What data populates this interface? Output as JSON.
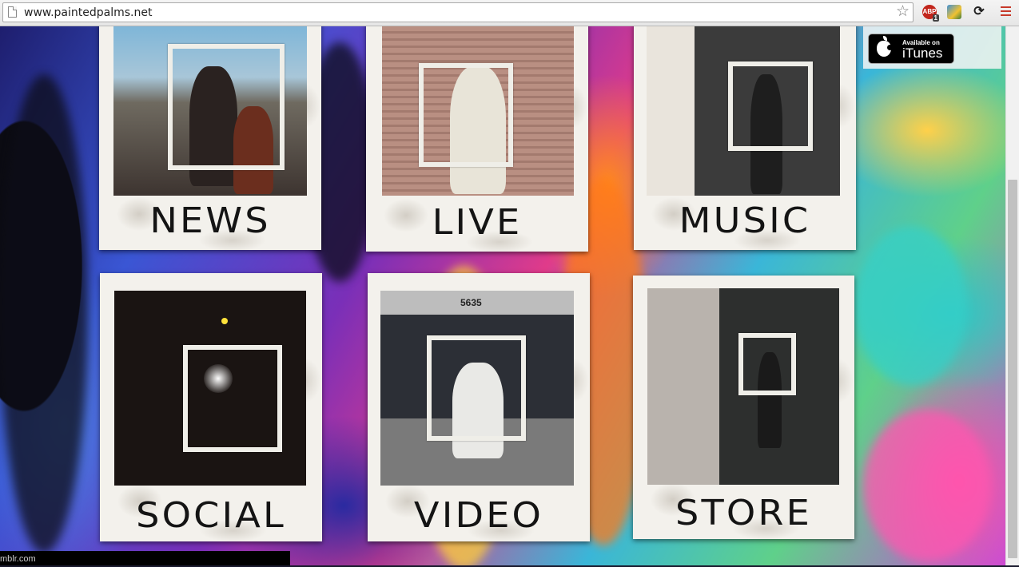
{
  "browser": {
    "url": "www.paintedpalms.net",
    "extensions": {
      "abp_label": "ABP",
      "abp_badge": "1"
    }
  },
  "itunes": {
    "small_text": "Available on",
    "big_text": "iTunes"
  },
  "nav": [
    {
      "label": "NEWS"
    },
    {
      "label": "LIVE"
    },
    {
      "label": "MUSIC"
    },
    {
      "label": "SOCIAL"
    },
    {
      "label": "VIDEO"
    },
    {
      "label": "STORE"
    }
  ],
  "status_bar": {
    "text": "mblr.com"
  },
  "colors": {
    "polaroid": "#f3f1ec",
    "ink": "#141414",
    "menu_icon": "#c73a2b"
  }
}
